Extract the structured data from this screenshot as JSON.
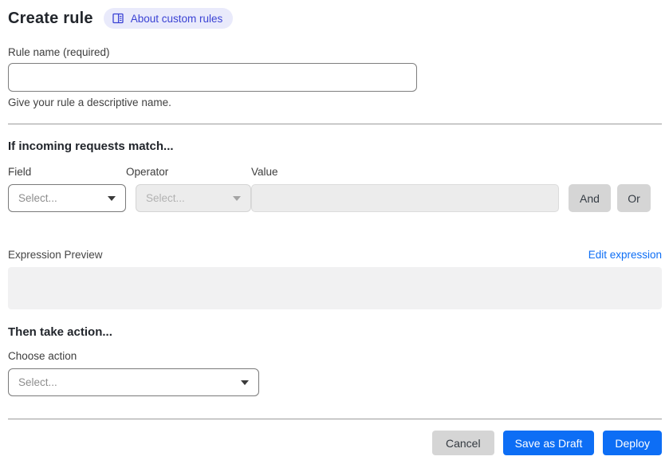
{
  "header": {
    "title": "Create rule",
    "about_badge": "About custom rules"
  },
  "rule_name": {
    "label": "Rule name (required)",
    "value": "",
    "helper": "Give your rule a descriptive name."
  },
  "match": {
    "heading": "If incoming requests match...",
    "field_label": "Field",
    "field_value": "Select...",
    "operator_label": "Operator",
    "operator_value": "Select...",
    "value_label": "Value",
    "value_text": "",
    "and_label": "And",
    "or_label": "Or"
  },
  "expression": {
    "preview_label": "Expression Preview",
    "edit_link": "Edit expression",
    "preview_value": ""
  },
  "action": {
    "heading": "Then take action...",
    "label": "Choose action",
    "value": "Select..."
  },
  "footer": {
    "cancel": "Cancel",
    "save_draft": "Save as Draft",
    "deploy": "Deploy"
  },
  "icons": {
    "badge_icon": "book-icon",
    "select_icon": "caret-down-icon"
  },
  "colors": {
    "primary_blue": "#0d6ef5",
    "link_blue": "#0d6ef5",
    "badge_bg": "#e9eafb",
    "badge_text": "#3a42d4",
    "neutral_button_bg": "#d5d5d5",
    "disabled_field_bg": "#ececec",
    "preview_box_bg": "#f1f1f2",
    "divider": "#9b9b9b",
    "heading_text": "#21252b"
  }
}
